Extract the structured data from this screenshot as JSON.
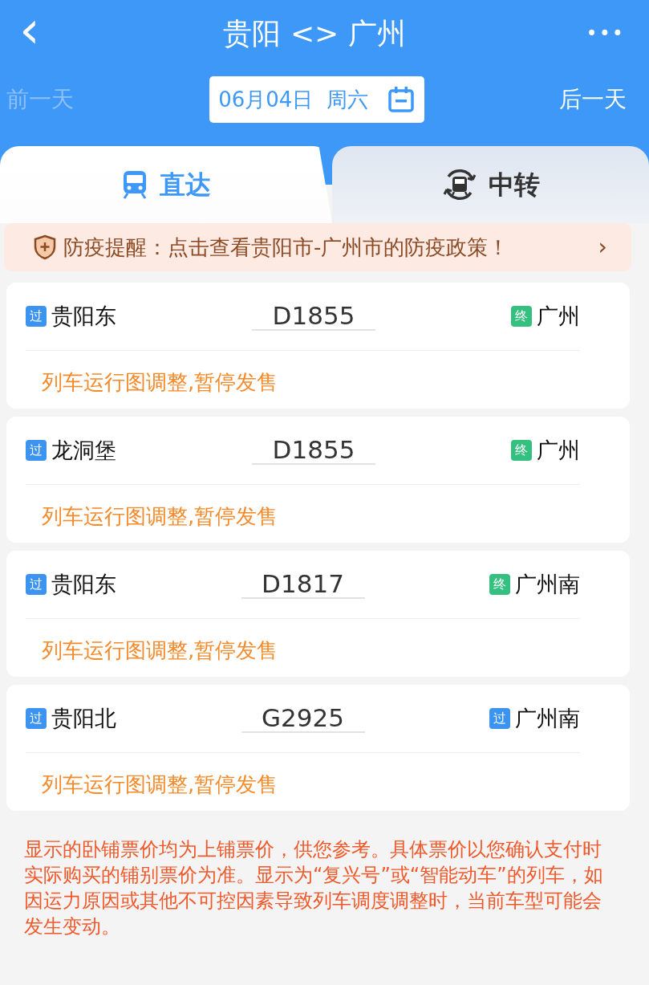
{
  "header": {
    "back": "‹",
    "title": "贵阳 <> 广州",
    "more": "•••"
  },
  "date_bar": {
    "prev": {
      "label": "前一天",
      "disabled": true
    },
    "date": "06月04日  周六",
    "next": {
      "label": "后一天",
      "disabled": false
    }
  },
  "tabs": [
    {
      "label": "直达",
      "kind": "direct",
      "selected": true
    },
    {
      "label": "中转",
      "kind": "transfer",
      "selected": false
    }
  ],
  "notice": {
    "text": "防疫提醒：点击查看贵阳市-广州市的防疫政策！",
    "arrow": "›"
  },
  "trains": [
    {
      "from_badge": {
        "text": "过",
        "color": "#3c94f0"
      },
      "from": "贵阳东",
      "number": "D1855",
      "to_badge": {
        "text": "终",
        "color": "#34c07e"
      },
      "to": "广州",
      "status": "列车运行图调整,暂停发售"
    },
    {
      "from_badge": {
        "text": "过",
        "color": "#3c94f0"
      },
      "from": "龙洞堡",
      "number": "D1855",
      "to_badge": {
        "text": "终",
        "color": "#34c07e"
      },
      "to": "广州",
      "status": "列车运行图调整,暂停发售"
    },
    {
      "from_badge": {
        "text": "过",
        "color": "#3c94f0"
      },
      "from": "贵阳东",
      "number": "D1817",
      "to_badge": {
        "text": "终",
        "color": "#34c07e"
      },
      "to": "广州南",
      "status": "列车运行图调整,暂停发售"
    },
    {
      "from_badge": {
        "text": "过",
        "color": "#3c94f0"
      },
      "from": "贵阳北",
      "number": "G2925",
      "to_badge": {
        "text": "过",
        "color": "#3c94f0"
      },
      "to": "广州南",
      "status": "列车运行图调整,暂停发售"
    }
  ],
  "footnote": "显示的卧铺票价均为上铺票价，供您参考。具体票价以您确认支付时实际购买的铺别票价为准。显示为“复兴号”或“智能动车”的列车，如因运力原因或其他不可控因素导致列车调度调整时，当前车型可能会发生变动。"
}
